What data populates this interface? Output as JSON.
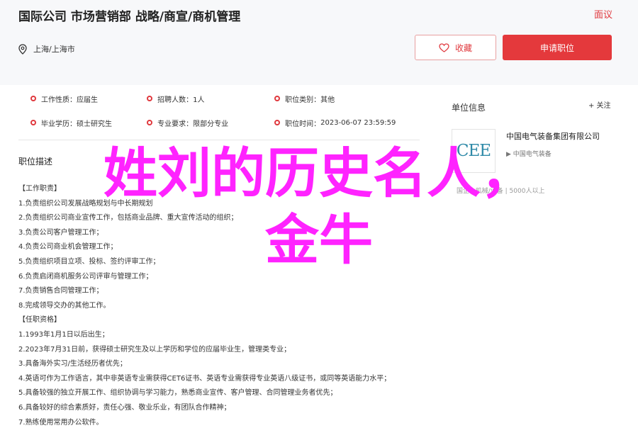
{
  "header": {
    "title": "国际公司 市场营销部 战略/商宣/商机管理",
    "report_label": "面议",
    "location": "上海/上海市",
    "favorite_label": "收藏",
    "apply_label": "申请职位"
  },
  "meta": [
    {
      "label": "工作性质：",
      "value": "应届生"
    },
    {
      "label": "招聘人数：",
      "value": "1人"
    },
    {
      "label": "职位类别：",
      "value": "其他"
    },
    {
      "label": "毕业学历：",
      "value": "硕士研究生"
    },
    {
      "label": "专业要求：",
      "value": "限部分专业"
    },
    {
      "label": "职位时间：",
      "value": "2023-06-07 23:59:59"
    }
  ],
  "section_title": "职位描述",
  "description_lines": [
    "【工作职责】",
    "1.负责组织公司发展战略规划与中长期规划",
    "2.负责组织公司商业宣传工作，包括商业品牌、重大宣传活动的组织；",
    "3.负责公司客户管理工作；",
    "4.负责公司商业机会管理工作；",
    "5.负责组织项目立项、投标、签约评审工作；",
    "6.负责启闭商机服务公司评审与管理工作；",
    "7.负责销售合同管理工作；",
    "8.完成领导交办的其他工作。",
    "【任职资格】",
    "1.1993年1月1日以后出生；",
    "2.2023年7月31日前，获得硕士研究生及以上学历和学位的应届毕业生，管理类专业；",
    "3.具备海外实习/生活经历者优先；",
    "4.英语可作为工作语言，其中非英语专业需获得CET6证书、英语专业需获得专业英语八级证书，或同等英语能力水平；",
    "5.具备较强的独立开展工作、组织协调与学习能力，熟悉商业宣传、客户管理、合同管理业务者优先；",
    "6.具备较好的综合素质好，责任心强、敬业乐业，有团队合作精神；",
    "7.熟练使用常用办公软件。"
  ],
  "sidebar": {
    "title": "单位信息",
    "follow_label": "+ 关注",
    "logo_text": "CEE",
    "company_name": "中国电气装备集团有限公司",
    "company_sub": "▶ 中国电气装备",
    "company_tags": "国企 | 机械/设备 | 5000人以上"
  },
  "overlay": {
    "line1": "姓刘的历史名人，",
    "line2": "金牛"
  },
  "colors": {
    "accent": "#e4393c",
    "overlay": "#ff23ff"
  }
}
